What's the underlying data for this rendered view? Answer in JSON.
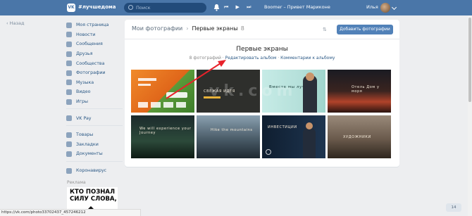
{
  "header": {
    "logo": "VK",
    "hashtag": "#лучшедома",
    "search_placeholder": "Поиск",
    "player_controls": "⏮ ▶ ⏭",
    "track": "Boomer – Привет Мариконе",
    "user_name": "Илья"
  },
  "back_link": "Назад",
  "sidebar": {
    "items": [
      {
        "label": "Моя страница",
        "icon": "home-icon"
      },
      {
        "label": "Новости",
        "icon": "news-icon"
      },
      {
        "label": "Сообщения",
        "icon": "messages-icon"
      },
      {
        "label": "Друзья",
        "icon": "friends-icon"
      },
      {
        "label": "Сообщества",
        "icon": "groups-icon"
      },
      {
        "label": "Фотографии",
        "icon": "camera-icon"
      },
      {
        "label": "Музыка",
        "icon": "music-icon"
      },
      {
        "label": "Видео",
        "icon": "video-icon"
      },
      {
        "label": "Игры",
        "icon": "games-icon"
      }
    ],
    "items2": [
      {
        "label": "VK Pay",
        "icon": "vkpay-icon"
      }
    ],
    "items3": [
      {
        "label": "Товары",
        "icon": "goods-icon"
      },
      {
        "label": "Закладки",
        "icon": "bookmark-icon"
      },
      {
        "label": "Документы",
        "icon": "docs-icon"
      }
    ],
    "items4": [
      {
        "label": "Коронавирус",
        "icon": "virus-icon"
      }
    ],
    "ads_label": "Реклама",
    "ad_text": "КТО ПОЗНАЛ СИЛУ СЛОВА,"
  },
  "album": {
    "breadcrumb_root": "Мои фотографии",
    "breadcrumb_current": "Первые экраны",
    "breadcrumb_count": "8",
    "add_button": "Добавить фотографии",
    "title": "Первые экраны",
    "photo_count": "8 фотографий",
    "edit_link": "Редактировать альбом",
    "comments_link": "Комментарии к альбому"
  },
  "photos": [
    {
      "id": 1,
      "caption": ""
    },
    {
      "id": 2,
      "caption": "СВЕЖАЯ ИДЕЯ"
    },
    {
      "id": 3,
      "caption": "Вместе мы лучше"
    },
    {
      "id": 4,
      "caption": "Отель Дом у моря"
    },
    {
      "id": 5,
      "caption": "We will experience your Journey"
    },
    {
      "id": 6,
      "caption": "Hike the mountains"
    },
    {
      "id": 7,
      "caption": "ИНВЕСТИЦИИ"
    },
    {
      "id": 8,
      "caption": "ХУДОЖНИКИ"
    }
  ],
  "watermark": "vk.com",
  "status_url": "https://vk.com/photo33702437_457246212",
  "counter": "14"
}
